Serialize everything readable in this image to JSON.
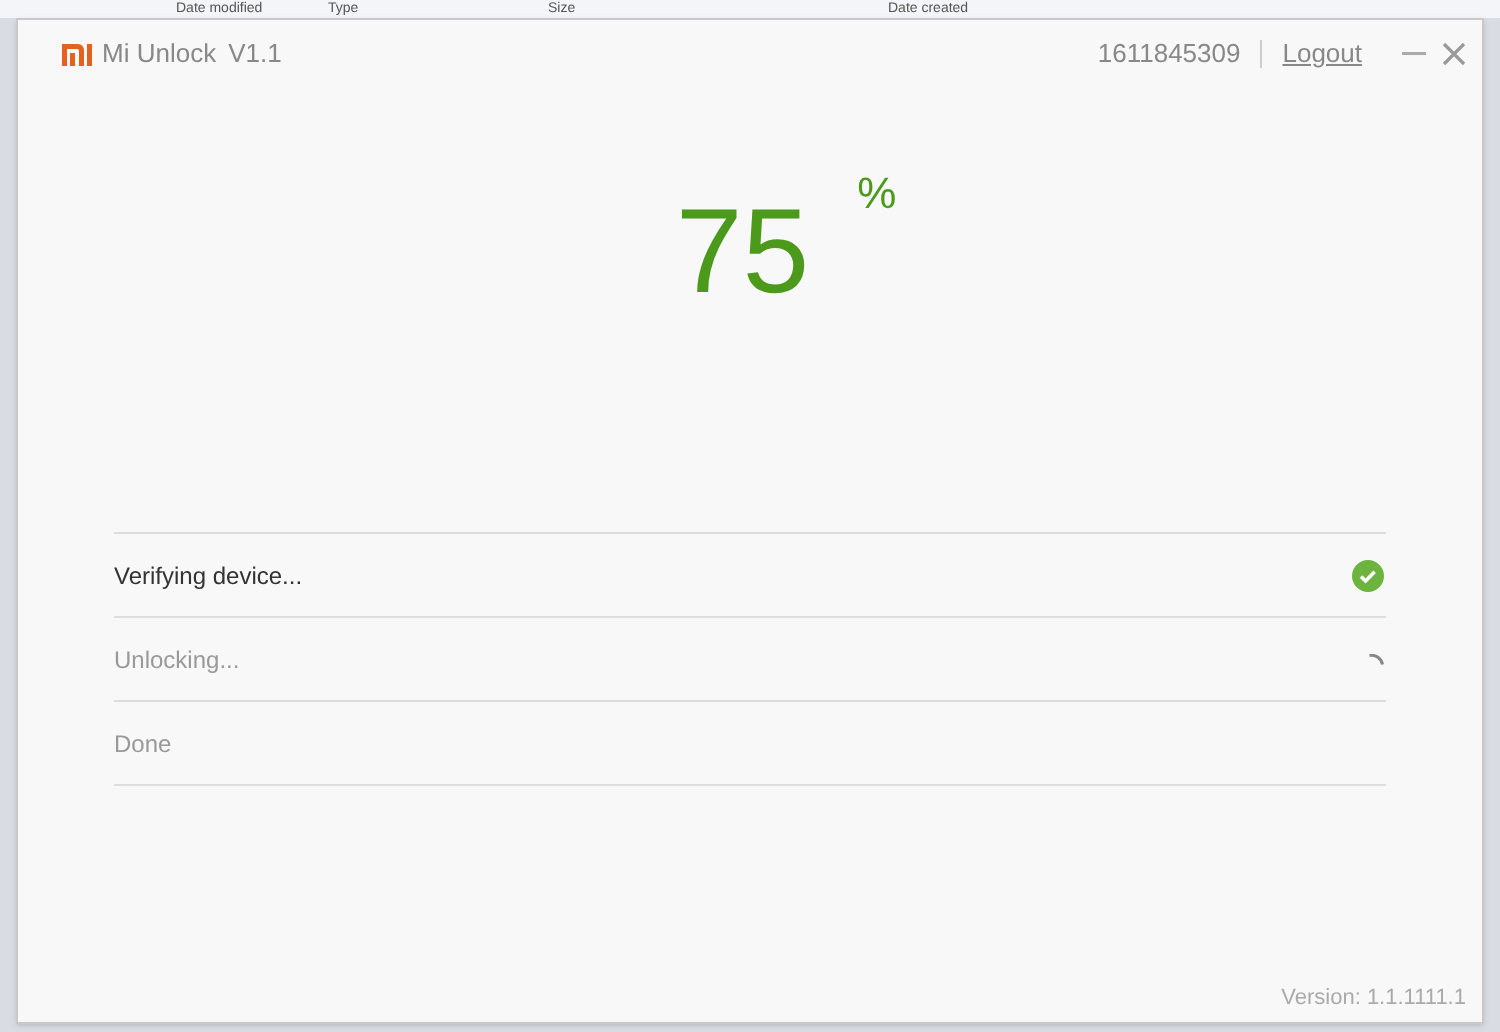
{
  "background_window": {
    "columns": [
      "Date modified",
      "Type",
      "Size",
      "Date created"
    ]
  },
  "window": {
    "app_name": "Mi Unlock",
    "version_label": "V1.1",
    "account_id": "1611845309",
    "logout": "Logout"
  },
  "progress": {
    "value": "75",
    "unit": "%"
  },
  "steps": [
    {
      "label": "Verifying device...",
      "completed": true,
      "in_progress": false
    },
    {
      "label": "Unlocking...",
      "completed": false,
      "in_progress": true
    },
    {
      "label": "Done",
      "completed": false,
      "in_progress": false
    }
  ],
  "footer": {
    "version": "Version: 1.1.1111.1"
  }
}
